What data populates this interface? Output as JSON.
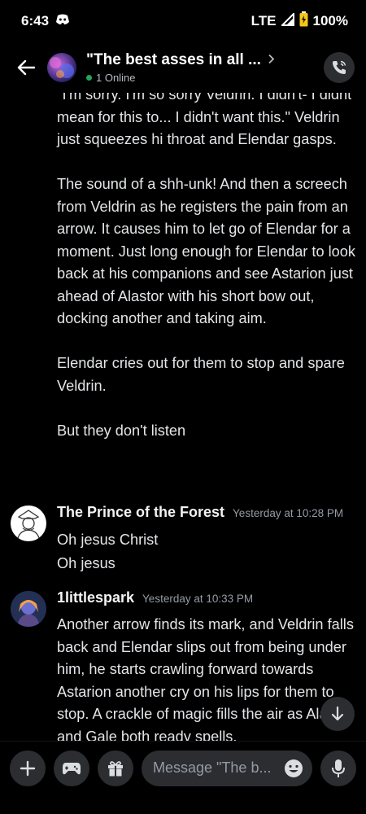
{
  "status_bar": {
    "time": "6:43",
    "network": "LTE",
    "battery": "100%"
  },
  "header": {
    "title": "\"The best asses in all ...",
    "online_status": "1 Online"
  },
  "messages": {
    "continuation": [
      "\"I'm sorry. I'm so sorry Veldrin. I didn't- I didnt mean for this to... I didn't want this.\" Veldrin just squeezes hi throat and Elendar gasps.",
      "The sound of a shh-unk! And then a screech from Veldrin as he registers the pain from an arrow. It causes him to let go of Elendar for a moment. Just long enough for Elendar to look back at his companions and see Astarion just ahead of Alastor with his short bow out, docking another and taking aim.",
      "Elendar cries out for them to stop and spare Veldrin.",
      "But they don't listen"
    ],
    "groups": [
      {
        "username": "The Prince of the Forest",
        "timestamp": "Yesterday at 10:28 PM",
        "lines": [
          "Oh jesus Christ",
          "Oh jesus"
        ]
      },
      {
        "username": "1littlespark",
        "timestamp": "Yesterday at 10:33 PM",
        "lines": [
          "Another arrow finds its mark, and Veldrin falls back and Elendar slips out from being under him, he starts crawling forward towards Astarion another cry on his lips for them to stop. A crackle of magic fills the air as Alastor and Gale both ready spells."
        ]
      }
    ]
  },
  "composer": {
    "placeholder": "Message \"The b..."
  },
  "colors": {
    "background": "#000000",
    "surface": "#2b2d31",
    "online": "#23a55a",
    "muted_text": "#949ba4"
  }
}
